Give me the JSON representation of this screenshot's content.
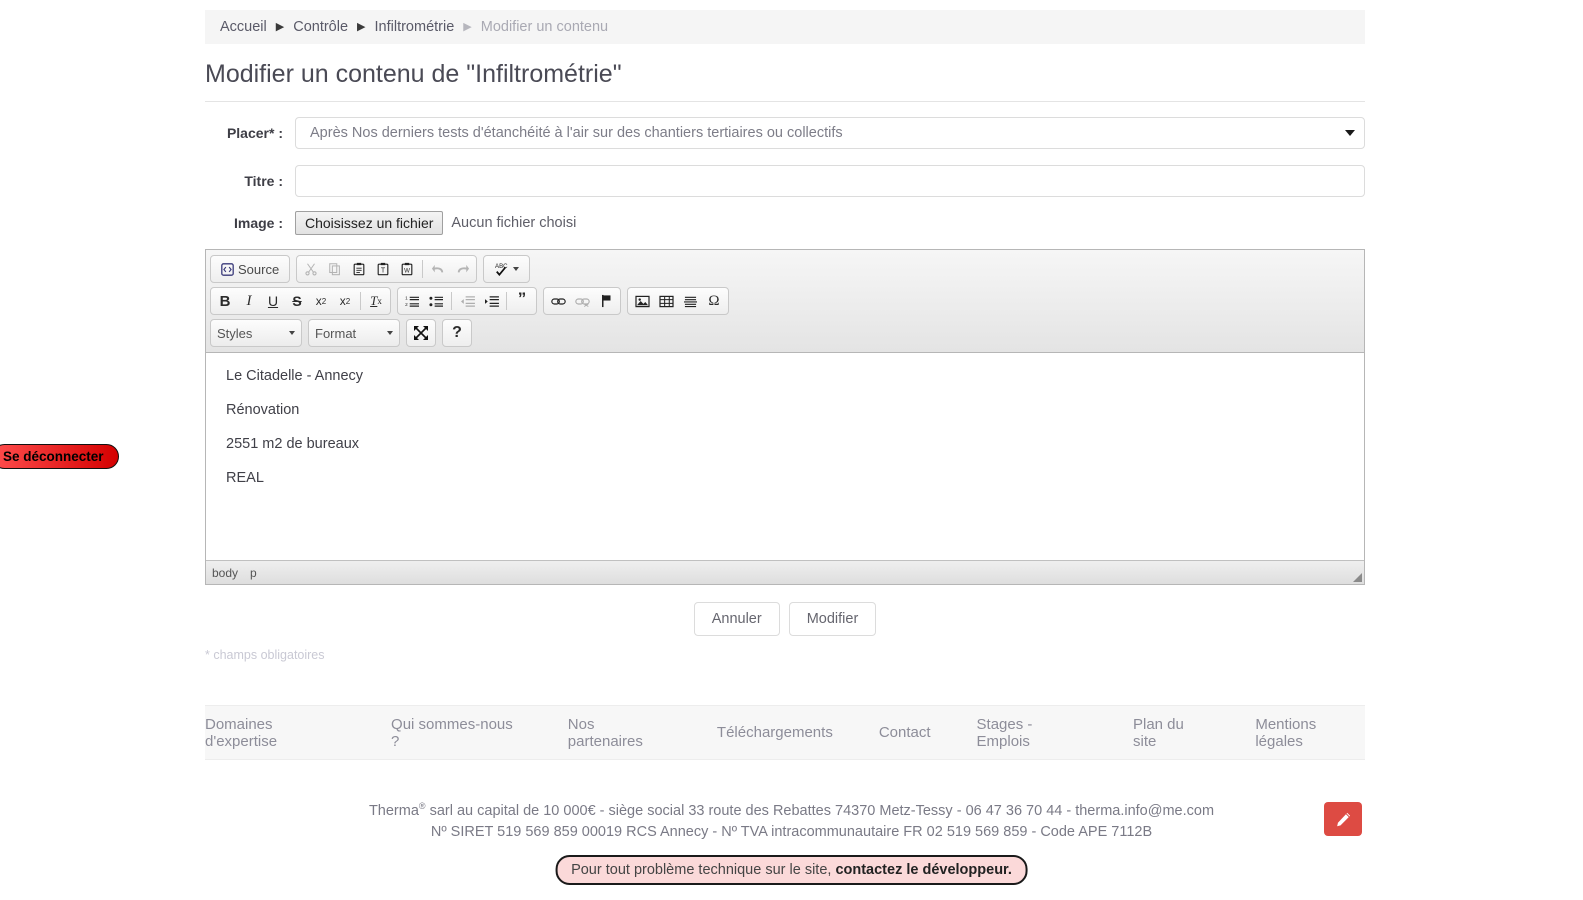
{
  "breadcrumb": {
    "items": [
      {
        "label": "Accueil",
        "current": false
      },
      {
        "label": "Contrôle",
        "current": false
      },
      {
        "label": "Infiltrométrie",
        "current": false
      },
      {
        "label": "Modifier un contenu",
        "current": true
      }
    ],
    "separator": "▶"
  },
  "page": {
    "title": "Modifier un contenu de \"Infiltrométrie\""
  },
  "form": {
    "placer": {
      "label": "Placer",
      "required_mark": "*",
      "colon": ":",
      "value": "Après Nos derniers tests d'étanchéité à l'air sur des chantiers tertiaires ou collectifs"
    },
    "titre": {
      "label": "Titre :",
      "value": "",
      "placeholder": ""
    },
    "image": {
      "label": "Image :",
      "button_label": "Choisissez un fichier",
      "status": "Aucun fichier choisi"
    },
    "required_note": "* champs obligatoires"
  },
  "editor": {
    "toolbar": {
      "source_label": "Source",
      "row1": [
        {
          "name": "source-button",
          "glyph": "◧",
          "disabled": false
        },
        {
          "name": "cut-button",
          "glyph": "✂",
          "disabled": true
        },
        {
          "name": "copy-button",
          "glyph": "❐",
          "disabled": true
        },
        {
          "name": "paste-button",
          "glyph": "📋",
          "disabled": false
        },
        {
          "name": "paste-as-plain-text-button",
          "glyph": "T",
          "disabled": false
        },
        {
          "name": "paste-from-word-button",
          "glyph": "W",
          "disabled": false
        },
        {
          "name": "undo-button",
          "glyph": "↩",
          "disabled": true
        },
        {
          "name": "redo-button",
          "glyph": "↪",
          "disabled": true
        },
        {
          "name": "spell-check-button",
          "glyph": "ABC",
          "disabled": false
        }
      ],
      "row2": [
        {
          "name": "bold-button",
          "glyph": "B",
          "disabled": false
        },
        {
          "name": "italic-button",
          "glyph": "I",
          "disabled": false
        },
        {
          "name": "underline-button",
          "glyph": "U",
          "disabled": false
        },
        {
          "name": "strikethrough-button",
          "glyph": "S",
          "disabled": false
        },
        {
          "name": "subscript-button",
          "glyph": "x₂",
          "disabled": false
        },
        {
          "name": "superscript-button",
          "glyph": "x²",
          "disabled": false
        },
        {
          "name": "remove-format-button",
          "glyph": "Tₓ",
          "disabled": false
        },
        {
          "name": "numbered-list-button",
          "glyph": "1.",
          "disabled": false
        },
        {
          "name": "bulleted-list-button",
          "glyph": "•",
          "disabled": false
        },
        {
          "name": "outdent-button",
          "glyph": "⇤",
          "disabled": true
        },
        {
          "name": "indent-button",
          "glyph": "⇥",
          "disabled": false
        },
        {
          "name": "blockquote-button",
          "glyph": "”",
          "disabled": false
        },
        {
          "name": "link-button",
          "glyph": "🔗",
          "disabled": false
        },
        {
          "name": "unlink-button",
          "glyph": "🔗",
          "disabled": true
        },
        {
          "name": "anchor-button",
          "glyph": "⚑",
          "disabled": false
        },
        {
          "name": "image-button",
          "glyph": "🖼",
          "disabled": false
        },
        {
          "name": "table-button",
          "glyph": "▦",
          "disabled": false
        },
        {
          "name": "horizontal-rule-button",
          "glyph": "☰",
          "disabled": false
        },
        {
          "name": "special-character-button",
          "glyph": "Ω",
          "disabled": false
        }
      ],
      "styles_label": "Styles",
      "format_label": "Format",
      "maximize_label": "Maximize",
      "help_label": "?"
    },
    "content": [
      "Le Citadelle - Annecy",
      "Rénovation",
      "2551 m2 de bureaux",
      "REAL"
    ],
    "elements_path": [
      "body",
      "p"
    ]
  },
  "actions": {
    "cancel_label": "Annuler",
    "submit_label": "Modifier"
  },
  "footer": {
    "links": [
      "Domaines d'expertise",
      "Qui sommes-nous ?",
      "Nos partenaires",
      "Téléchargements",
      "Contact",
      "Stages - Emplois",
      "Plan du site",
      "Mentions légales"
    ],
    "legal_line1_pre": "Therma",
    "legal_line1_sup": "®",
    "legal_line1_post": " sarl au capital de 10 000€ - siège social 33 route des Rebattes 74370 Metz-Tessy - 06 47 36 70 44 - therma.info@me.com",
    "legal_line2": "Nº SIRET 519 569 859 00019 RCS Annecy - Nº TVA intracommunautaire FR 02 519 569 859 - Code APE 7112B",
    "dev_notice_pre": "Pour tout problème technique sur le site, ",
    "dev_notice_link": "contactez le développeur."
  },
  "logout": {
    "label": "Se déconnecter"
  },
  "fab": {
    "name": "edit-pencil-icon"
  },
  "colors": {
    "accent_red": "#dd4b43",
    "logout_red": "#d40000",
    "dev_box_bg": "#fbd9d9",
    "breadcrumb_bg": "#f5f5f5"
  }
}
